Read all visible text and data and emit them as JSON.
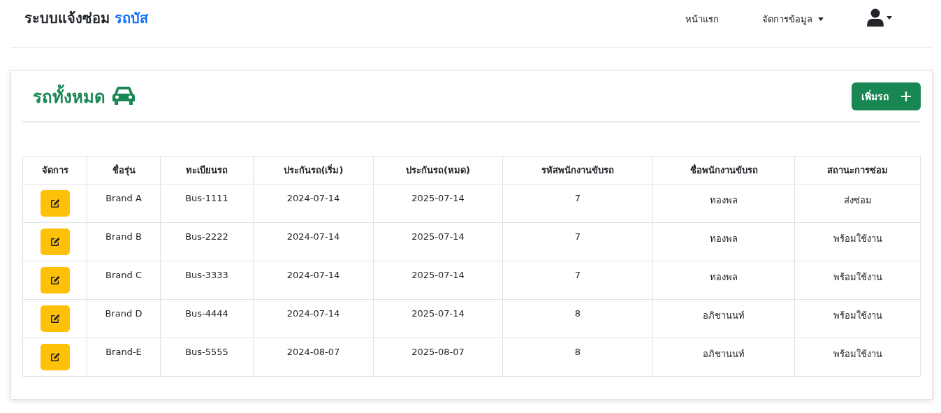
{
  "brand": {
    "title": "ระบบแจ้งซ่อม",
    "highlight": "รถบัส"
  },
  "nav": [
    {
      "label": "หน้าแรก",
      "dropdown": false
    },
    {
      "label": "จัดการข้อมูล",
      "dropdown": true
    }
  ],
  "card": {
    "title": "รถทั้งหมด",
    "add_button": "เพิ่มรถ"
  },
  "table": {
    "columns": [
      "จัดการ",
      "ชื่อรุ่น",
      "ทะเบียนรถ",
      "ประกันรถ(เริ่ม)",
      "ประกันรถ(หมด)",
      "รหัสพนักงานขับรถ",
      "ชื่อพนักงานขับรถ",
      "สถานะการซ่อม"
    ],
    "rows": [
      {
        "cells": [
          "",
          "Brand A",
          "Bus-1111",
          "2024-07-14",
          "2025-07-14",
          "7",
          "ทองพล",
          "ส่งซ่อม"
        ]
      },
      {
        "cells": [
          "",
          "Brand B",
          "Bus-2222",
          "2024-07-14",
          "2025-07-14",
          "7",
          "ทองพล",
          "พร้อมใช้งาน"
        ]
      },
      {
        "cells": [
          "",
          "Brand C",
          "Bus-3333",
          "2024-07-14",
          "2025-07-14",
          "7",
          "ทองพล",
          "พร้อมใช้งาน"
        ]
      },
      {
        "cells": [
          "",
          "Brand D",
          "Bus-4444",
          "2024-07-14",
          "2025-07-14",
          "8",
          "อภิชานนท์",
          "พร้อมใช้งาน"
        ]
      },
      {
        "cells": [
          "",
          "Brand-E",
          "Bus-5555",
          "2024-08-07",
          "2025-08-07",
          "8",
          "อภิชานนท์",
          "พร้อมใช้งาน"
        ]
      }
    ]
  }
}
